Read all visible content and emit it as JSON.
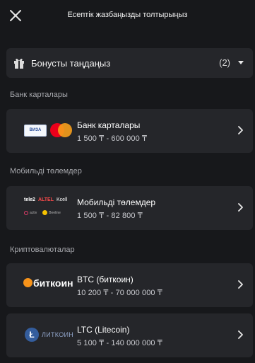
{
  "header": {
    "title": "Есептік жазбаңызды толтырыңыз"
  },
  "bonus": {
    "label": "Бонусты таңдаңыз",
    "count": "(2)"
  },
  "sections": {
    "bank": "Банк карталары",
    "mobile": "Мобильді төлемдер",
    "crypto": "Криптовалюталар"
  },
  "methods": {
    "bank_card": {
      "name": "Банк карталары",
      "range": "1 500 ₸ - 600 000 ₸",
      "logo_text": "ВИЗА"
    },
    "mobile": {
      "name": "Мобильді төлемдер",
      "range": "1 500 ₸ - 82 800 ₸",
      "logo_tele2": "tele2",
      "logo_altel": "ALTEL",
      "logo_kcell": "Kcell",
      "logo_activ": "activ",
      "logo_beeline": "Beeline"
    },
    "btc": {
      "name": "BTC (биткоин)",
      "range": "10 200 ₸ - 70 000 000 ₸",
      "logo_text": "биткоин"
    },
    "ltc": {
      "name": "LTC (Litecoin)",
      "range": "5 100 ₸ - 140 000 000 ₸",
      "logo_text": "ЛИТКОИН",
      "logo_letter": "Ł"
    }
  },
  "colors": {
    "background": "#17181b",
    "card": "#25262a",
    "muted_text": "#a7a8ad",
    "btc_orange": "#f7931a",
    "ltc_blue": "#345d9d"
  }
}
